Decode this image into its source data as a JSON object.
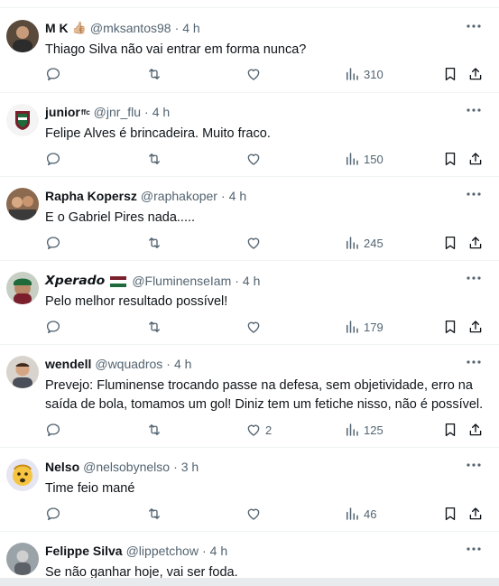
{
  "tweets": [
    {
      "name": "M K",
      "name_emoji": "👍🏼",
      "handle": "@mksantos98",
      "sep": "·",
      "time": "4 h",
      "text": "Thiago Silva não vai entrar em forma nunca?",
      "replies": "",
      "retweets": "",
      "likes": "",
      "views": "310"
    },
    {
      "name": "junior",
      "name_sup": "ffc",
      "handle": "@jnr_flu",
      "sep": "·",
      "time": "4 h",
      "text": "Felipe Alves é brincadeira. Muito fraco.",
      "replies": "",
      "retweets": "",
      "likes": "",
      "views": "150"
    },
    {
      "name": "Rapha Kopersz",
      "handle": "@raphakoper",
      "sep": "·",
      "time": "4 h",
      "text": "E o Gabriel Pires nada.....",
      "replies": "",
      "retweets": "",
      "likes": "",
      "views": "245"
    },
    {
      "name": "𝙓𝙥𝙚𝙧𝙖𝙙𝙤",
      "handle": "@FluminenseIam",
      "sep": "·",
      "time": "4 h",
      "text": "Pelo melhor resultado possível!",
      "replies": "",
      "retweets": "",
      "likes": "",
      "views": "179"
    },
    {
      "name": "wendell",
      "handle": "@wquadros",
      "sep": "·",
      "time": "4 h",
      "text": "Prevejo: Fluminense trocando passe na defesa, sem objetividade, erro na saída de bola, tomamos um gol! Diniz tem um fetiche nisso, não é possível.",
      "replies": "",
      "retweets": "",
      "likes": "2",
      "views": "125"
    },
    {
      "name": "Nelso",
      "handle": "@nelsobynelso",
      "sep": "·",
      "time": "3 h",
      "text": "Time feio mané",
      "replies": "",
      "retweets": "",
      "likes": "",
      "views": "46"
    },
    {
      "name": "Felippe Silva",
      "handle": "@lippetchow",
      "sep": "·",
      "time": "4 h",
      "text": "Se não ganhar hoje, vai ser foda.",
      "replies": "",
      "retweets": "",
      "likes": "",
      "views": ""
    }
  ],
  "colors": {
    "text": "#0f1419",
    "secondary": "#536471",
    "divider": "#eff3f4"
  },
  "icons": [
    "more-icon",
    "reply-icon",
    "retweet-icon",
    "like-icon",
    "views-icon",
    "bookmark-icon",
    "share-icon"
  ]
}
